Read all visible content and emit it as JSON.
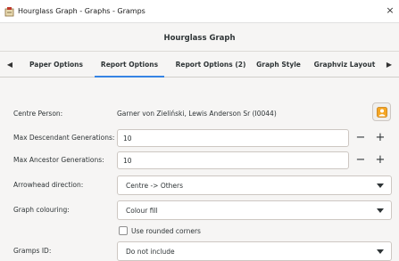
{
  "window": {
    "title": "Hourglass Graph - Graphs - Gramps",
    "close_glyph": "×"
  },
  "dialog": {
    "heading": "Hourglass Graph"
  },
  "tabs": {
    "left_arrow": "◀",
    "right_arrow": "▶",
    "items": [
      {
        "label": "Paper Options",
        "active": false
      },
      {
        "label": "Report Options",
        "active": true
      },
      {
        "label": "Report Options (2)",
        "active": false
      },
      {
        "label": "Graph Style",
        "active": false
      },
      {
        "label": "Graphviz Layout",
        "active": false
      }
    ]
  },
  "options": {
    "centre_person": {
      "label": "Centre Person:",
      "value": "Garner von Zieliński, Lewis Anderson Sr (I0044)"
    },
    "max_descendant": {
      "label": "Max Descendant Generations:",
      "value": "10",
      "minus": "−",
      "plus": "+"
    },
    "max_ancestor": {
      "label": "Max Ancestor Generations:",
      "value": "10",
      "minus": "−",
      "plus": "+"
    },
    "arrowhead": {
      "label": "Arrowhead direction:",
      "value": "Centre -> Others"
    },
    "colouring": {
      "label": "Graph colouring:",
      "value": "Colour fill"
    },
    "rounded_corners": {
      "label": "Use rounded corners",
      "checked": false
    },
    "gramps_id": {
      "label": "Gramps ID:",
      "value": "Do not include"
    }
  },
  "colors": {
    "accent": "#3584e4",
    "icon_orange": "#f5a623"
  },
  "icons": {
    "app": "gramps-app-icon",
    "person_select": "person-select-icon"
  }
}
